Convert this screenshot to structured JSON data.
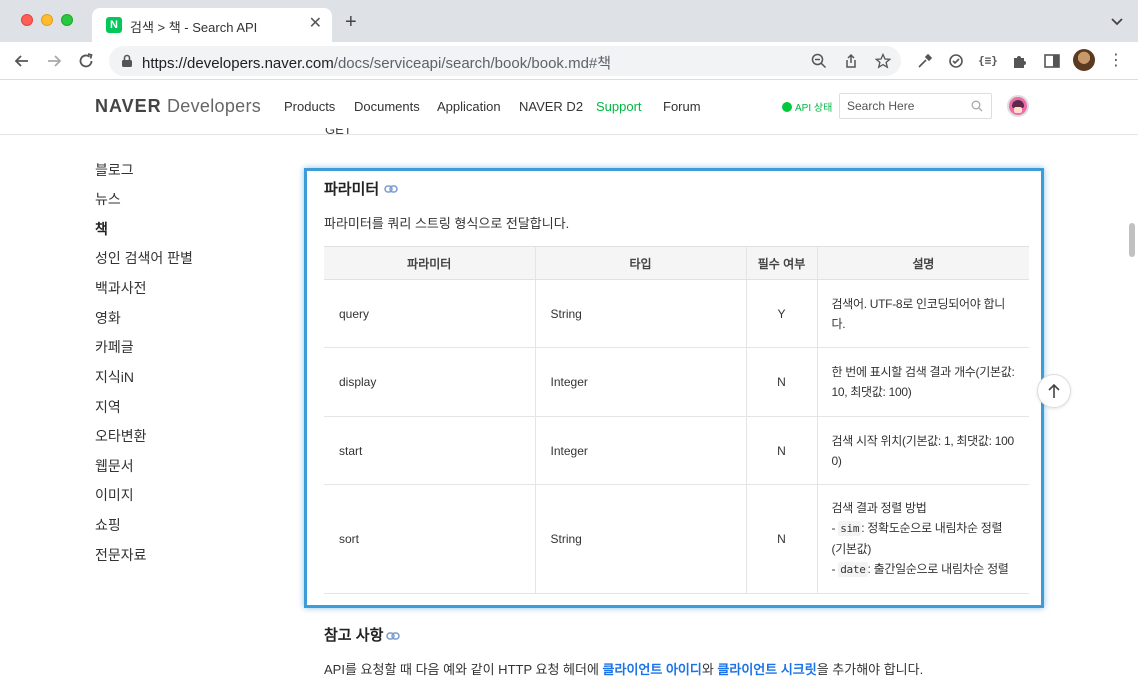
{
  "browser": {
    "tab_title": "검색 > 책 - Search API",
    "tab_favicon_letter": "N",
    "url_host": "https://developers.naver.com",
    "url_path": "/docs/serviceapi/search/book/book.md#책"
  },
  "header": {
    "logo_bold": "NAVER",
    "logo_light": "Developers",
    "nav": [
      {
        "label": "Products"
      },
      {
        "label": "Documents"
      },
      {
        "label": "Application"
      },
      {
        "label": "NAVER D2"
      },
      {
        "label": "Support"
      },
      {
        "label": "Forum"
      }
    ],
    "api_status": "API 상태",
    "search_placeholder": "Search Here"
  },
  "sidebar": {
    "items": [
      {
        "label": "블로그"
      },
      {
        "label": "뉴스"
      },
      {
        "label": "책"
      },
      {
        "label": "성인 검색어 판별"
      },
      {
        "label": "백과사전"
      },
      {
        "label": "영화"
      },
      {
        "label": "카페글"
      },
      {
        "label": "지식iN"
      },
      {
        "label": "지역"
      },
      {
        "label": "오타변환"
      },
      {
        "label": "웹문서"
      },
      {
        "label": "이미지"
      },
      {
        "label": "쇼핑"
      },
      {
        "label": "전문자료"
      }
    ]
  },
  "content": {
    "method_text": "GET",
    "params_heading": "파라미터",
    "params_desc": "파라미터를 쿼리 스트링 형식으로 전달합니다.",
    "table": {
      "headers": [
        "파라미터",
        "타입",
        "필수 여부",
        "설명"
      ],
      "rows": [
        {
          "name": "query",
          "type": "String",
          "required": "Y",
          "desc_1": "검색어. UTF-8로 인코딩되어야 합니",
          "desc_2": "다."
        },
        {
          "name": "display",
          "type": "Integer",
          "required": "N",
          "desc_1": "한 번에 표시할 검색 결과 개수(기본값:",
          "desc_2": "10, 최댓값: 100)"
        },
        {
          "name": "start",
          "type": "Integer",
          "required": "N",
          "desc_1": "검색 시작 위치(기본값: 1, 최댓값: 100",
          "desc_2": "0)"
        },
        {
          "name": "sort",
          "type": "String",
          "required": "N",
          "desc_1": "검색 결과 정렬 방법",
          "opt1_code": "sim",
          "opt1_desc": ": 정확도순으로 내림차순 정렬",
          "opt1_desc_2": "(기본값)",
          "opt2_code": "date",
          "opt2_desc": ": 출간일순으로 내림차순 정렬"
        }
      ]
    },
    "notes_heading": "참고 사항",
    "bottom_pre": "API를 요청할 때 다음 예와 같이 HTTP 요청 헤더에 ",
    "bottom_link1": "클라이언트 아이디",
    "bottom_mid": "와 ",
    "bottom_link2": "클라이언트 시크릿",
    "bottom_post": "을 추가해야 합니다."
  },
  "colors": {
    "accent_green": "#00b843",
    "highlight_blue": "#3d9bd8",
    "link_blue": "#1a73e8"
  }
}
